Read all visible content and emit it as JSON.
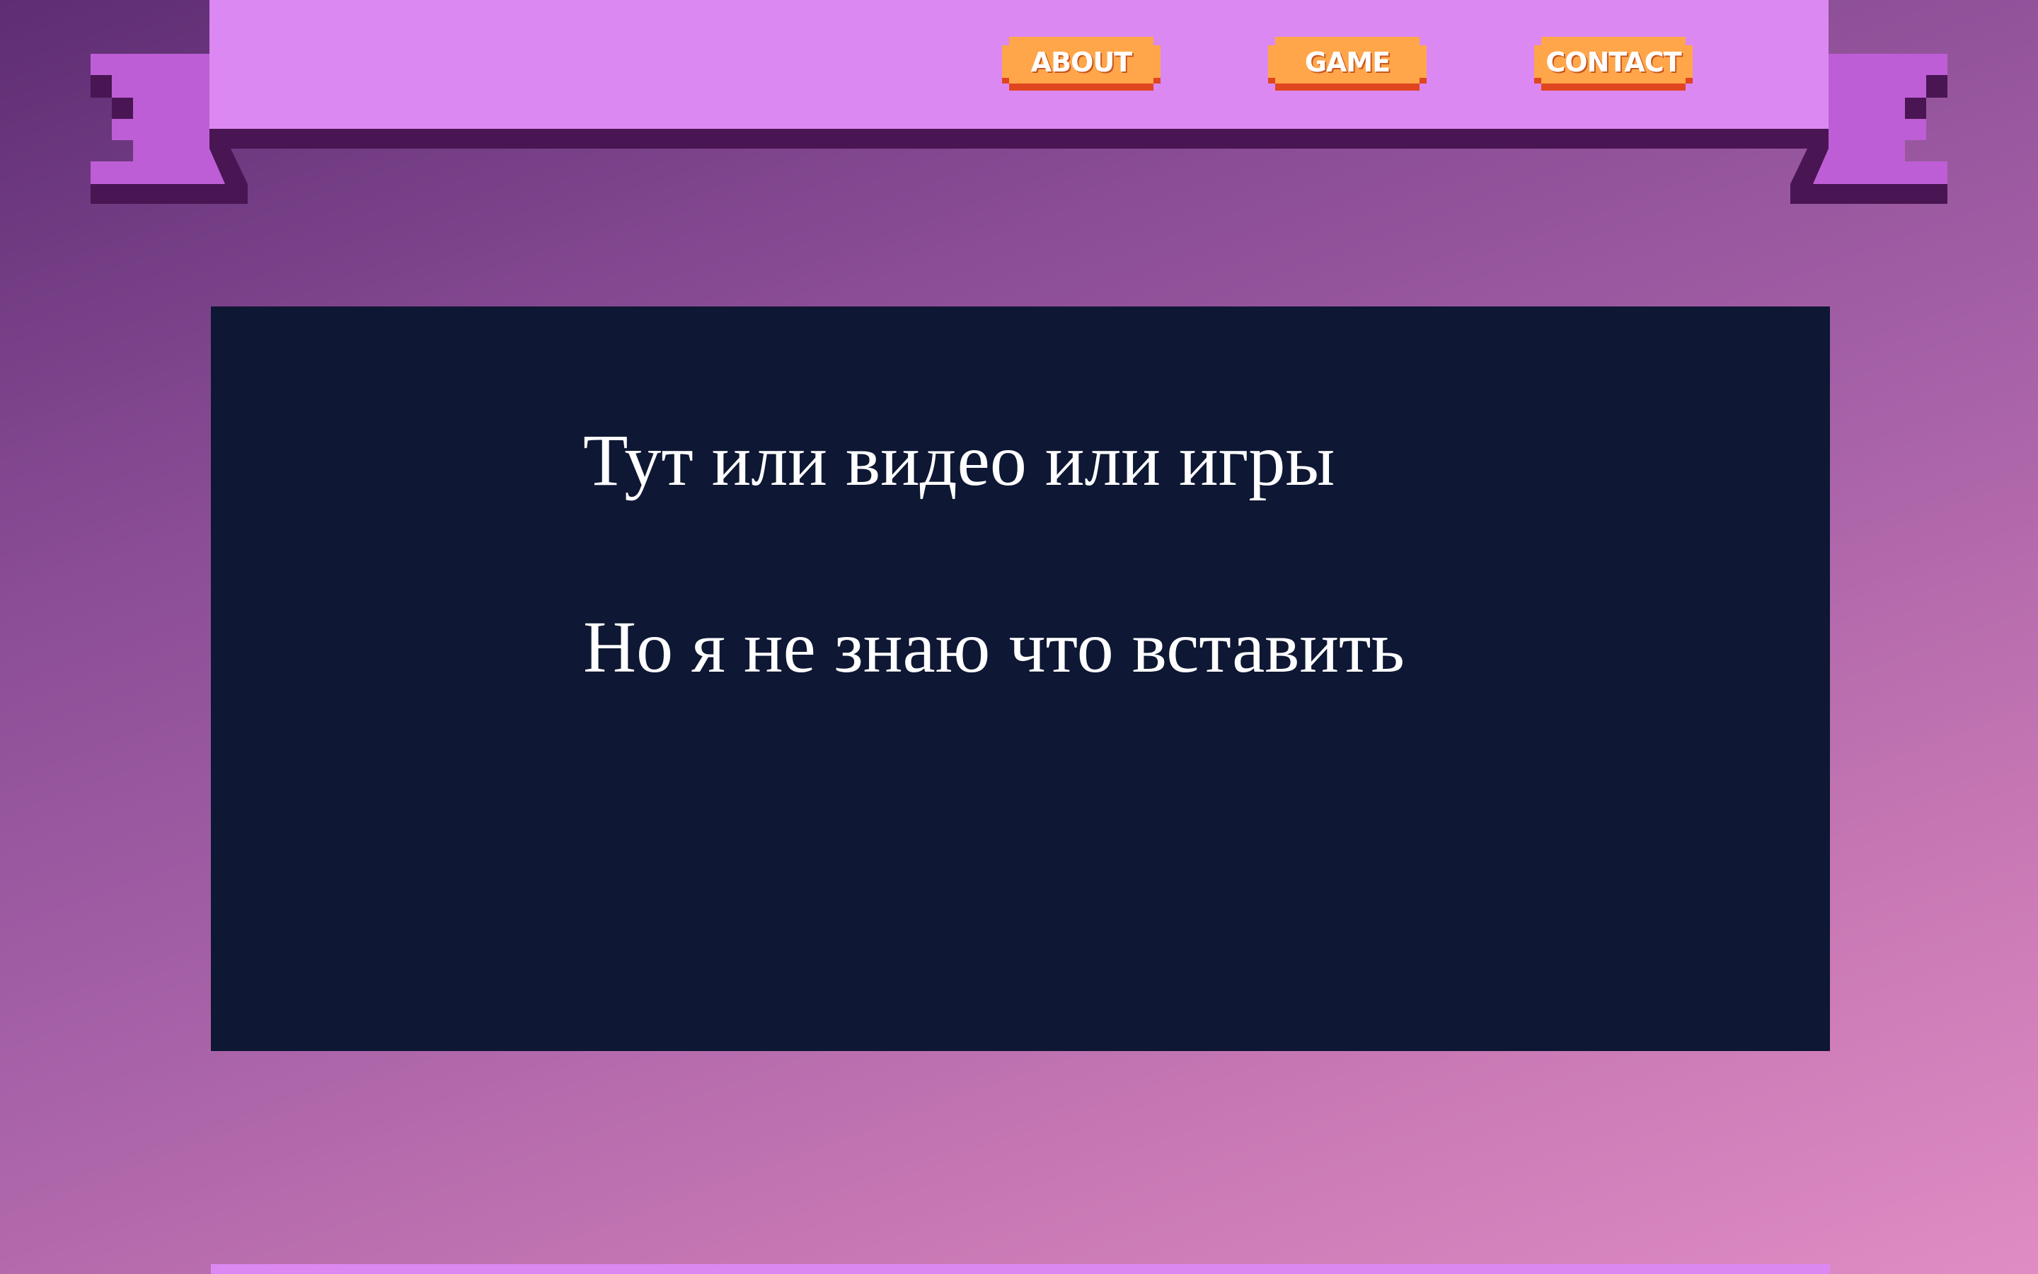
{
  "header": {
    "nav": [
      {
        "label": "ABOUT"
      },
      {
        "label": "GAME"
      },
      {
        "label": "CONTACT"
      }
    ]
  },
  "main": {
    "line_1": "Тут или видео или игры",
    "line_2": "Но я не знаю что вставить"
  },
  "colors": {
    "header_bar": "#dc88f2",
    "ribbon_tail": "#be5ed6",
    "ribbon_shadow": "#4a1553",
    "nav_button": "#ffa64a",
    "nav_button_shadow": "#e0451f",
    "content_panel": "#0e1733",
    "content_text": "#ffffff"
  }
}
